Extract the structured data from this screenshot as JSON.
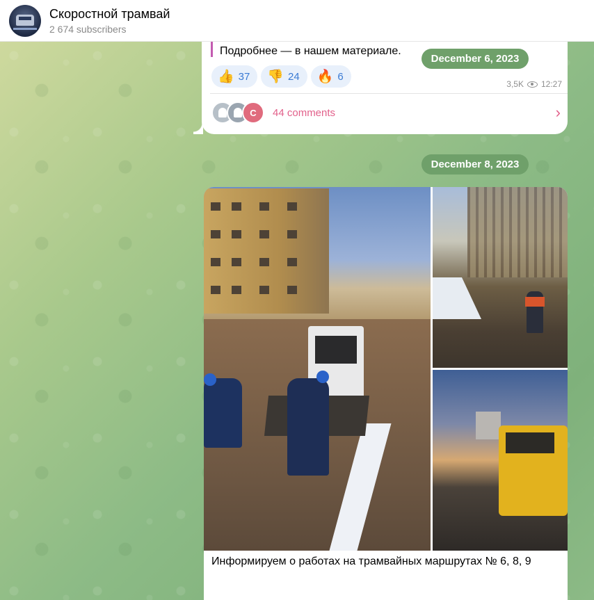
{
  "header": {
    "channel_name": "Скоростной трамвай",
    "subscribers": "2 674 subscribers"
  },
  "post1": {
    "text_tail": "Подробнее — в нашем материале.",
    "reactions": [
      {
        "emoji": "👍",
        "count": "37"
      },
      {
        "emoji": "👎",
        "count": "24"
      },
      {
        "emoji": "🔥",
        "count": "6"
      }
    ],
    "views": "3,5K",
    "time": "12:27",
    "commenter_initial": "C",
    "comments_label": "44 comments"
  },
  "date_pills": {
    "first": "December 6, 2023",
    "second": "December 8, 2023"
  },
  "post2": {
    "photos": [
      "road-works-main",
      "road-works-trees",
      "road-works-grader"
    ],
    "caption": "Информируем о работах на трамвайных маршрутах № 6, 8, 9"
  },
  "colors": {
    "accent_pink": "#e2618b",
    "reaction_bg": "#e8f0fb",
    "reaction_count": "#3b7bd4",
    "date_pill": "#6fa06a"
  }
}
